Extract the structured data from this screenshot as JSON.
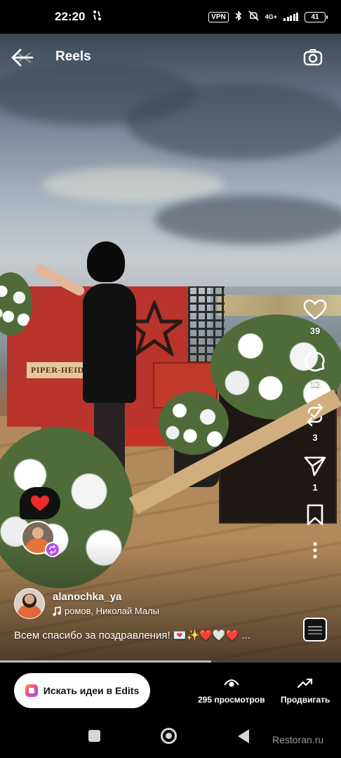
{
  "status_bar": {
    "time": "22:20",
    "vpn": "VPN",
    "network": "4G+",
    "battery": "41"
  },
  "header": {
    "title": "Reels"
  },
  "actions": {
    "likes": "39",
    "comments": "12",
    "reposts": "3",
    "shares": "1"
  },
  "reel": {
    "author": "alanochka_ya",
    "music": "ромов, Николай Малы",
    "caption": "Всем спасибо за поздравления! 💌✨❤️🤍❤️",
    "caption_more": "...",
    "progress": 0.62
  },
  "bottom_bar": {
    "edits_label": "Искать идеи в Edits",
    "views_label": "295 просмотров",
    "boost_label": "Продвигать"
  },
  "watermark": "Restoran.ru",
  "colors": {
    "like_red": "#ed2b2b",
    "edits_gradient_start": "#f5a623",
    "edits_gradient_end": "#8b5cf6"
  }
}
